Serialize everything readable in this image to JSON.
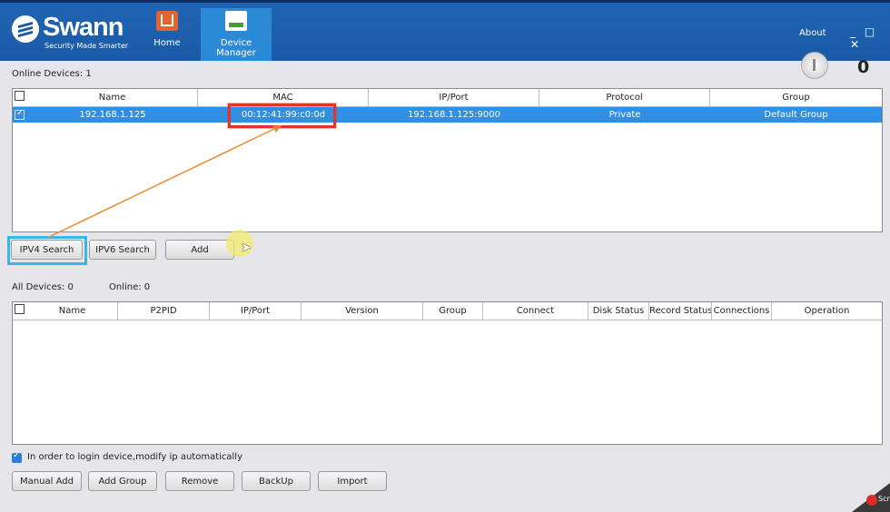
{
  "app": {
    "brand": "Swann",
    "tagline": "Security Made Smarter"
  },
  "nav": {
    "home_label": "Home",
    "device_manager_label": "Device Manager"
  },
  "window": {
    "about_label": "About",
    "controls": "_ □ ✕",
    "alarm_count": "0"
  },
  "online": {
    "label": "Online Devices:  1",
    "columns": [
      "Name",
      "MAC",
      "IP/Port",
      "Protocol",
      "Group"
    ],
    "rows": [
      {
        "name": "192.168.1.125",
        "mac": "00:12:41:99:c0:0d",
        "ip_port": "192.168.1.125:9000",
        "protocol": "Private",
        "group": "Default Group",
        "checked": true
      }
    ]
  },
  "search_buttons": {
    "ipv4": "IPV4 Search",
    "ipv6": "IPV6 Search",
    "add": "Add"
  },
  "all": {
    "all_label": "All Devices:  0",
    "online_label": "Online:  0",
    "columns": [
      "Name",
      "P2PID",
      "IP/Port",
      "Version",
      "Group",
      "Connect",
      "Disk Status",
      "Record Status",
      "Connections",
      "Operation"
    ],
    "rows": []
  },
  "auto_ip": {
    "label": "In order to login device,modify ip automatically",
    "checked": true
  },
  "bottom_buttons": {
    "manual_add": "Manual Add",
    "add_group": "Add Group",
    "remove": "Remove",
    "backup": "BackUp",
    "import": "Import"
  },
  "overlay": {
    "corner_text": "Scre"
  },
  "colors": {
    "header": "#1a5aa6",
    "selected_row": "#2f8fe5",
    "highlight_red": "#e3342b",
    "highlight_blue": "#35b8e8",
    "arrow": "#f08a30"
  }
}
